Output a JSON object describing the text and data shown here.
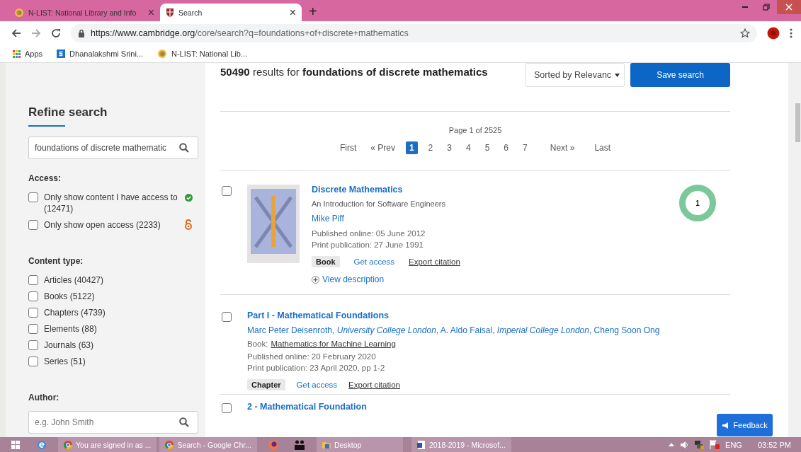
{
  "browser": {
    "tabs": [
      {
        "title": "N-LIST: National Library and Info",
        "selected": false,
        "close": "×"
      },
      {
        "title": "Search",
        "selected": true,
        "close": "×"
      }
    ],
    "new_tab": "+",
    "url_host": "https://www.cambridge.org",
    "url_path": "/core/search?q=foundations+of+discrete+mathematics",
    "bookmarks": [
      {
        "label": "Apps",
        "kind": "apps"
      },
      {
        "label": "Dhanalakshmi Srini...",
        "kind": "site"
      },
      {
        "label": "N-LIST: National Lib...",
        "kind": "nlist"
      }
    ]
  },
  "sidebar": {
    "title": "Refine search",
    "search": {
      "value": "foundations of discrete mathematic"
    },
    "access": {
      "heading": "Access:",
      "options": [
        {
          "label": "Only show content I have access to (12471)",
          "checked": false,
          "kind": "access"
        },
        {
          "label": "Only show open access (2233)",
          "checked": false,
          "kind": "open"
        }
      ]
    },
    "content_type": {
      "heading": "Content type:",
      "options": [
        {
          "label": "Articles (40427)",
          "checked": false
        },
        {
          "label": "Books (5122)",
          "checked": false
        },
        {
          "label": "Chapters (4739)",
          "checked": false
        },
        {
          "label": "Elements (88)",
          "checked": false
        },
        {
          "label": "Journals (63)",
          "checked": false
        },
        {
          "label": "Series (51)",
          "checked": false
        }
      ]
    },
    "author": {
      "heading": "Author:",
      "placeholder": "e.g. John Smith"
    }
  },
  "results_header": {
    "summary": "**50490** results for **foundations of discrete mathematics**",
    "sort": "Sorted by Relevanc",
    "save": "Save search"
  },
  "pagination": {
    "summary": "Page 1 of 2525",
    "first": "First",
    "prev": "« Prev",
    "pages": [
      {
        "label": "1",
        "selected": true
      },
      {
        "label": "2",
        "selected": false
      },
      {
        "label": "3",
        "selected": false
      },
      {
        "label": "4",
        "selected": false
      },
      {
        "label": "5",
        "selected": false
      },
      {
        "label": "6",
        "selected": false
      },
      {
        "label": "7",
        "selected": false
      }
    ],
    "next": "Next »",
    "last": "Last"
  },
  "results": [
    {
      "kind": "book",
      "checked": false,
      "title": "Discrete Mathematics",
      "subtitle": "An Introduction for Software Engineers",
      "authors": "Mike Piff",
      "published": "Published online: 05 June 2012",
      "print": "Print publication: 27 June 1991",
      "type": "Book",
      "access": "Get access",
      "export": "Export citation",
      "description": "View description",
      "altmetric": "1"
    },
    {
      "kind": "chapter",
      "checked": false,
      "title": "Part I - Mathematical Foundations",
      "authors": "Marc Peter Deisenroth, *University College London*, A. Aldo Faisal, *Imperial College London*, Cheng Soon Ong",
      "book_label": "Book:",
      "book_title": "Mathematics for Machine Learning",
      "published": "Published online: 20 February 2020",
      "print": "Print publication: 23 April 2020, pp 1-2",
      "type": "Chapter",
      "access": "Get access",
      "export": "Export citation"
    },
    {
      "kind": "partial",
      "checked": false,
      "title": "2 - Mathematical Foundation"
    }
  ],
  "feedback": "Feedback",
  "taskbar": {
    "items": [
      {
        "label": "You are signed in as ...",
        "kind": "chrome"
      },
      {
        "label": "Search - Google Chr...",
        "kind": "chrome"
      },
      {
        "label": "Desktop",
        "kind": "folder"
      },
      {
        "label": "2018-2019 - Microsof...",
        "kind": "word"
      }
    ],
    "language": "ENG",
    "time": "03:52 PM"
  }
}
